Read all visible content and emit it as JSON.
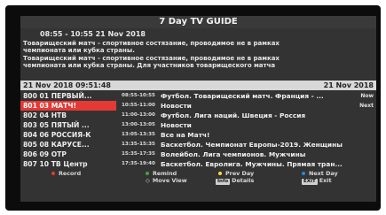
{
  "guide": {
    "title": "7 Day TV GUIDE",
    "time_range": "08:55 - 10:55  21 Nov 2018",
    "desc_lines": [
      "Товарищеский матч - спортивное состязание, проводимое не в рамках",
      "чемпионата или кубка страны.",
      "Товарищеский матч - спортивное состязание, проводимое не в рамках",
      "чемпионата или кубка страны. Для участников товарищеского матча"
    ],
    "current_datetime": "21 Nov 2018 09:51:48",
    "list_date": "21 Nov 2018"
  },
  "rows": [
    {
      "channel": "800 01 ПЕРВЫЙ...",
      "time": "08:55-10:55",
      "program": "Футбол. Товарищеский матч. Франция - ...",
      "tag": "Now"
    },
    {
      "channel": "801 03 МАТЧ!",
      "time": "10:55-11:00",
      "program": "Новости",
      "tag": "Next"
    },
    {
      "channel": "802 04 НТВ",
      "time": "11:00-13:00",
      "program": "Футбол. Лига наций. Швеция - Россия",
      "tag": ""
    },
    {
      "channel": "803 05 ПЯТЫЙ ...",
      "time": "13:00-13:05",
      "program": "Новости",
      "tag": ""
    },
    {
      "channel": "804 06 РОССИЯ-К",
      "time": "13:05-13:35",
      "program": "Все на Матч!",
      "tag": ""
    },
    {
      "channel": "805 08 КАРУСЕ...",
      "time": "13:35-15:35",
      "program": "Баскетбол. Чемпионат Европы-2019. Женщины",
      "tag": ""
    },
    {
      "channel": "806 09 ОТР",
      "time": "15:35-17:35",
      "program": "Волейбол. Лига чемпионов. Мужчины",
      "tag": ""
    },
    {
      "channel": "807 10 ТВ Центр",
      "time": "17:35-19:40",
      "program": "Баскетбол. Евролига. Мужчины. Прямая тран...",
      "tag": ""
    }
  ],
  "legend": {
    "record": "Record",
    "remind": "Remind",
    "prev_day": "Prev Day",
    "next_day": "Next Day",
    "move_view_icon": "◇",
    "move_view": "Move View",
    "info_key": "Info",
    "details": "Details",
    "exit_key": "EXIT",
    "exit": "Exit"
  },
  "colors": {
    "record": "#e53935",
    "remind": "#43a047",
    "prev_day": "#fdd835",
    "next_day": "#1e88e5",
    "selected_row": "#e53935"
  }
}
